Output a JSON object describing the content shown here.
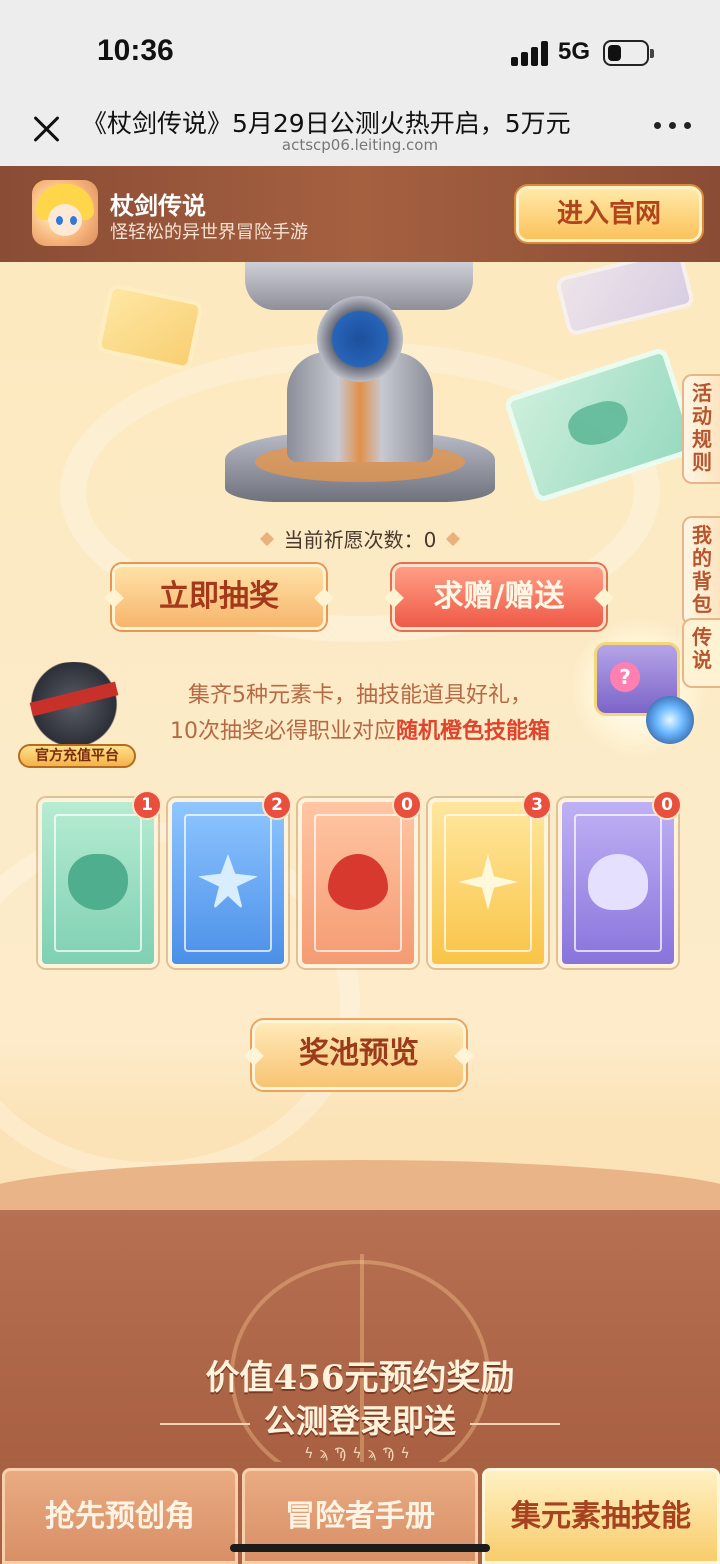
{
  "status_bar": {
    "time": "10:36",
    "network": "5G"
  },
  "browser": {
    "title": "《杖剑传说》5月29日公测火热开启，5万元",
    "url": "actscp06.leiting.com"
  },
  "app_banner": {
    "name": "杖剑传说",
    "desc": "怪轻松的异世界冒险手游",
    "enter_label": "进入官网"
  },
  "side_tabs": {
    "rules": "活动规则",
    "bag": "我的背包",
    "legend": "传说"
  },
  "wish": {
    "label": "当前祈愿次数：",
    "count": "0"
  },
  "buttons": {
    "draw": "立即抽奖",
    "gift": "求赠/赠送",
    "pool": "奖池预览"
  },
  "charge_badge": {
    "label": "官方充值平台"
  },
  "info": {
    "line1": "集齐5种元素卡，抽技能道具好礼，",
    "line2_prefix": "10次抽奖必得职业对应",
    "line2_highlight": "随机橙色技能箱"
  },
  "cards": [
    {
      "element": "wind",
      "count": "1",
      "color": "#7fd0b3"
    },
    {
      "element": "ice",
      "count": "2",
      "color": "#4b8fe8"
    },
    {
      "element": "fire",
      "count": "0",
      "color": "#f49b72"
    },
    {
      "element": "light",
      "count": "3",
      "color": "#f9c447"
    },
    {
      "element": "dark",
      "count": "0",
      "color": "#8874db"
    }
  ],
  "reward": {
    "title": "价值456元预约奖励",
    "subtitle": "公测登录即送"
  },
  "bottom_tabs": [
    {
      "label": "抢先预创角"
    },
    {
      "label": "冒险者手册"
    },
    {
      "label": "集元素抽技能"
    }
  ]
}
